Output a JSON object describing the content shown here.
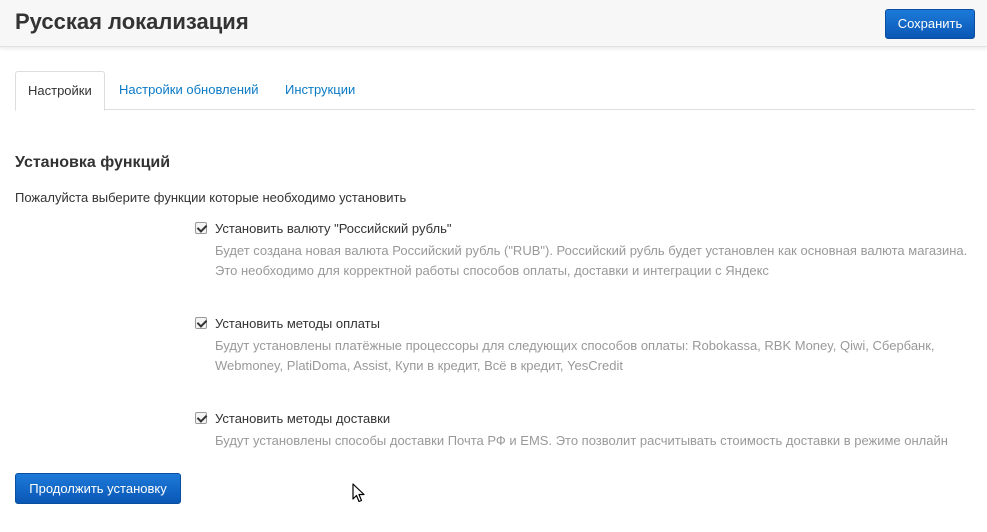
{
  "header": {
    "title": "Русская локализация",
    "save_label": "Сохранить"
  },
  "tabs": [
    {
      "label": "Настройки",
      "active": true
    },
    {
      "label": "Настройки обновлений",
      "active": false
    },
    {
      "label": "Инструкции",
      "active": false
    }
  ],
  "section": {
    "title": "Установка функций",
    "description": "Пожалуйста выберите функции которые необходимо установить"
  },
  "options": [
    {
      "label": "Установить валюту \"Российский рубль\"",
      "checked": true,
      "help": "Будет создана новая валюта Российский рубль (\"RUB\"). Российский рубль будет установлен как основная валюта магазина. Это необходимо для корректной работы способов оплаты, доставки и интеграции с Яндекс"
    },
    {
      "label": "Установить методы оплаты",
      "checked": true,
      "help": "Будут установлены платёжные процессоры для следующих способов оплаты: Robokassa, RBK Money, Qiwi, Сбербанк, Webmoney, PlatiDoma, Assist, Купи в кредит, Всё в кредит, YesCredit"
    },
    {
      "label": "Установить методы доставки",
      "checked": true,
      "help": "Будут установлены способы доставки Почта РФ и EMS. Это позволит расчитывать стоимость доставки в режиме онлайн"
    }
  ],
  "actions": {
    "continue_label": "Продолжить установку"
  },
  "colors": {
    "primary": "#0a63c4",
    "link": "#0a7ac5",
    "muted": "#999999"
  }
}
